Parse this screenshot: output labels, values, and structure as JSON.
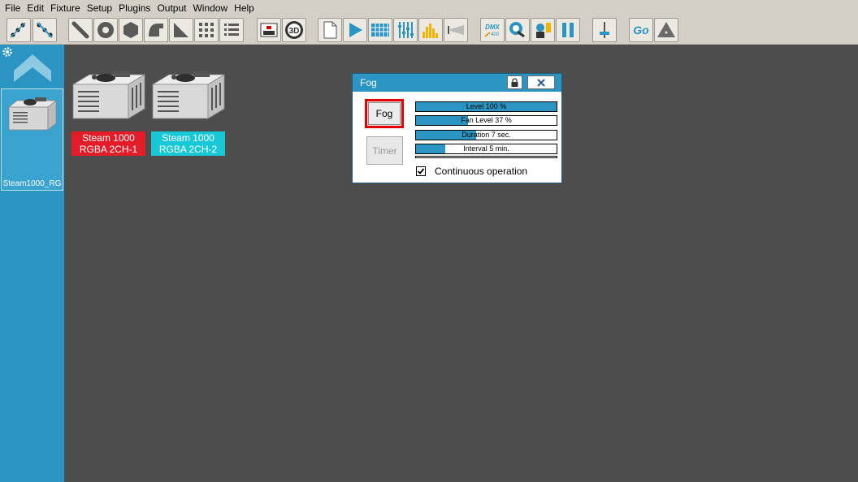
{
  "menu": [
    "File",
    "Edit",
    "Fixture",
    "Setup",
    "Plugins",
    "Output",
    "Window",
    "Help"
  ],
  "toolbar": {
    "dmx_label": "DMX",
    "dmx_sub": "400",
    "threed_label": "3D",
    "go_label": "Go"
  },
  "sidebar": {
    "fixture_label": "Steam1000_RG"
  },
  "fixtures": [
    {
      "line1": "Steam 1000",
      "line2": "RGBA 2CH-1",
      "color": "#e41c27"
    },
    {
      "line1": "Steam 1000",
      "line2": "RGBA 2CH-2",
      "color": "#17c8d6"
    }
  ],
  "dialog": {
    "title": "Fog",
    "fog_button": "Fog",
    "timer_button": "Timer",
    "bars": [
      {
        "label": "Level 100 %",
        "value": 100
      },
      {
        "label": "Fan Level 37 %",
        "value": 37
      },
      {
        "label": "Duration 7 sec.",
        "value": 43
      },
      {
        "label": "Interval 5 min.",
        "value": 21
      }
    ],
    "continuous_label": "Continuous operation",
    "continuous_checked": true
  },
  "colors": {
    "accent": "#2a94c2",
    "workspace": "#4d4d4d",
    "highlight": "#e60000"
  }
}
